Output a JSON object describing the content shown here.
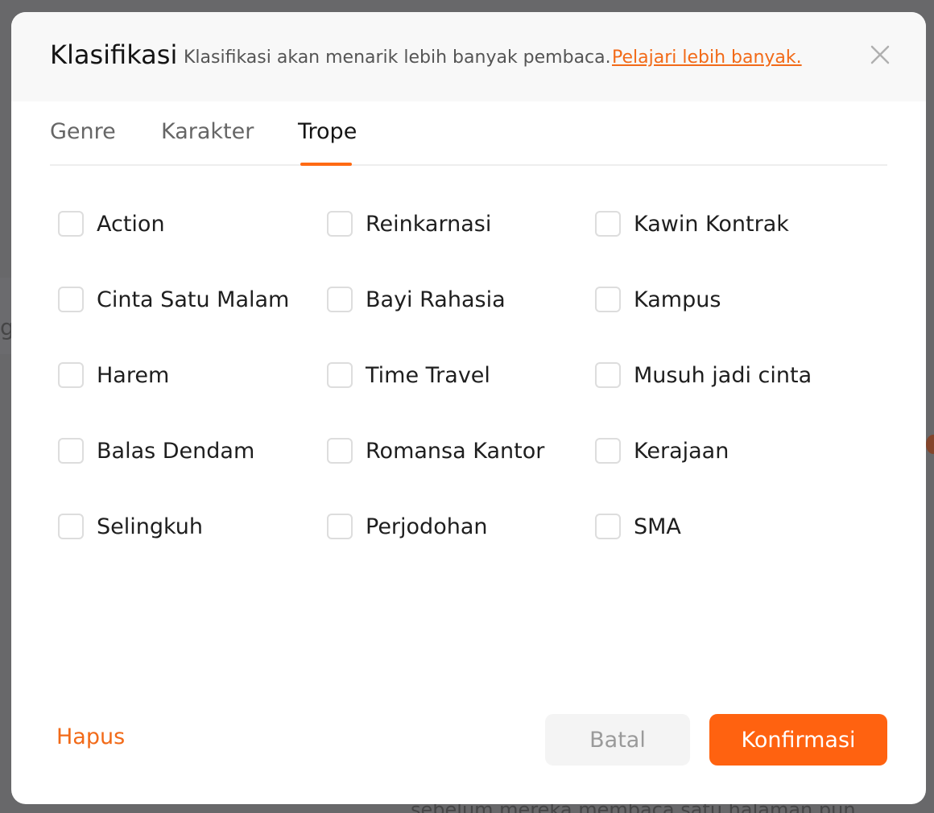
{
  "background": {
    "side_text": "g",
    "bottom_text": "sebelum mereka membaca satu halaman pun"
  },
  "modal": {
    "title": "Klasifikasi",
    "subtitle": "Klasifikasi akan menarik lebih banyak pembaca.",
    "learn_more": "Pelajari lebih banyak.",
    "close_icon": "close-icon"
  },
  "tabs": [
    {
      "label": "Genre",
      "active": false
    },
    {
      "label": "Karakter",
      "active": false
    },
    {
      "label": "Trope",
      "active": true
    }
  ],
  "options": [
    {
      "label": "Action",
      "checked": false
    },
    {
      "label": "Reinkarnasi",
      "checked": false
    },
    {
      "label": "Kawin Kontrak",
      "checked": false
    },
    {
      "label": "Cinta Satu Malam",
      "checked": false
    },
    {
      "label": "Bayi Rahasia",
      "checked": false
    },
    {
      "label": "Kampus",
      "checked": false
    },
    {
      "label": "Harem",
      "checked": false
    },
    {
      "label": "Time Travel",
      "checked": false
    },
    {
      "label": "Musuh jadi cinta",
      "checked": false
    },
    {
      "label": "Balas Dendam",
      "checked": false
    },
    {
      "label": "Romansa Kantor",
      "checked": false
    },
    {
      "label": "Kerajaan",
      "checked": false
    },
    {
      "label": "Selingkuh",
      "checked": false
    },
    {
      "label": "Perjodohan",
      "checked": false
    },
    {
      "label": "SMA",
      "checked": false
    }
  ],
  "footer": {
    "clear_label": "Hapus",
    "cancel_label": "Batal",
    "confirm_label": "Konfirmasi"
  },
  "colors": {
    "accent": "#ff6210",
    "link": "#f26a18"
  }
}
